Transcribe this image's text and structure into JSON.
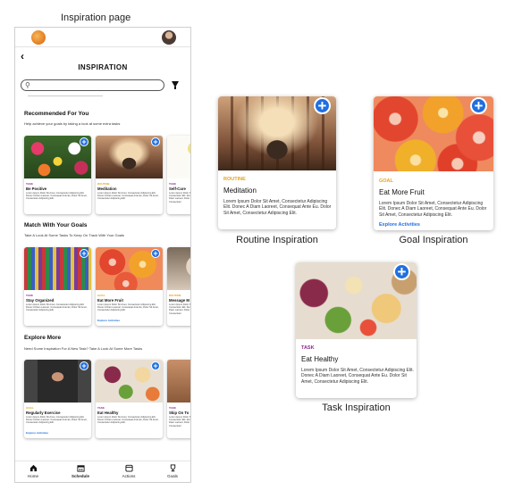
{
  "labels": {
    "inspiration_page": "Inspiration page",
    "routine": "Routine Inspiration",
    "goal": "Goal Inspiration",
    "task": "Task Inspiration"
  },
  "header": {
    "back": "‹",
    "title": "INSPIRATION"
  },
  "sections": {
    "recommended": {
      "title": "Recommended For You",
      "subtitle": "Help achieve your goals by taking a look at some extra tasks"
    },
    "match": {
      "title": "Match With Your Goals",
      "subtitle": "Take A Look At Some Tasks To Keep On Track With Your Goals"
    },
    "explore": {
      "title": "Explore More",
      "subtitle": "Need Some Inspiration For A New Task? Take A Look At Some More Tasks"
    }
  },
  "cards": {
    "r1": {
      "tag": "TASK",
      "name": "Be Positive",
      "desc": "Lorem Ipsum Dolor Sit Amet, Consectetur Adipiscing Elit. Donec A Diam Laoreet, Consequat Ante Eu, Dolor Sit Amet, Consectetur Adipiscing Elit.",
      "link": ""
    },
    "r2": {
      "tag": "ROUTINE",
      "name": "Meditation",
      "desc": "Lorem Ipsum Dolor Sit Amet, Consectetur Adipiscing Elit. Donec A Diam Laoreet, Consequat Ante Eu, Dolor Sit Amet, Consectetur Adipiscing Elit.",
      "link": ""
    },
    "r3": {
      "tag": "TASK",
      "name": "Self-Care",
      "desc": "Lorem Ipsum Dolor Sit Amet, Consectetur Elit. Donec A Diam Laoreet, Dolor Sit Amet, Consectetur",
      "link": ""
    },
    "m1": {
      "tag": "TASK",
      "name": "Stay Organized",
      "desc": "Lorem Ipsum Dolor Sit Amet, Consectetur Adipiscing Elit. Donec A Diam Laoreet, Consequat Ante Eu, Dolor Sit Amet, Consectetur Adipiscing Elit.",
      "link": ""
    },
    "m2": {
      "tag": "GOAL",
      "name": "Eat More Fruit",
      "desc": "Lorem Ipsum Dolor Sit Amet, Consectetur Adipiscing Elit. Donec A Diam Laoreet, Consequat Ante Eu, Dolor Sit Amet, Consectetur Adipiscing Elit.",
      "link": "Explore Activities"
    },
    "m3": {
      "tag": "ROUTINE",
      "name": "Message M",
      "desc": "Lorem Ipsum Dolor Sit Amet, Consectetur Elit. Donec A Diam Laoreet, Dolor Sit Amet, Consectetur",
      "link": ""
    },
    "e1": {
      "tag": "GOAL",
      "name": "Regularly Exercise",
      "desc": "Lorem Ipsum Dolor Sit Amet, Consectetur Adipiscing Elit. Donec A Diam Laoreet, Consequat Ante Eu, Dolor Sit Amet, Consectetur Adipiscing Elit.",
      "link": "Explore Activities"
    },
    "e2": {
      "tag": "TASK",
      "name": "Eat Healthy",
      "desc": "Lorem Ipsum Dolor Sit Amet, Consectetur Adipiscing Elit. Donec A Diam Laoreet, Consequat Ante Eu, Dolor Sit Amet, Consectetur Adipiscing Elit.",
      "link": ""
    },
    "e3": {
      "tag": "TASK",
      "name": "Skip On To",
      "desc": "Lorem Ipsum Dolor Sit Amet, Consectetur Elit. Donec A Diam Laoreet, Dolor Sit Amet, Consectetur",
      "link": ""
    }
  },
  "big": {
    "routine": {
      "tag": "ROUTINE",
      "name": "Meditation",
      "desc": "Lorem Ipsum Dolor Sit Amet, Consectetur Adipiscing Elit. Donec A Diam Laoreet, Consequat Ante Eu. Dolor Sit Amet, Consectetur Adipiscing Elit."
    },
    "goal": {
      "tag": "GOAL",
      "name": "Eat More Fruit",
      "desc": "Lorem Ipsum Dolor Sit Amet, Consectetur Adipiscing Elit. Donec A Diam Laoreet, Consequat Ante Eu. Dolor Sit Amet, Consectetur Adipiscing Elit.",
      "link": "Explore Activities"
    },
    "task": {
      "tag": "TASK",
      "name": "Eat Healthy",
      "desc": "Lorem Ipsum Dolor Sit Amet, Consectetur Adipiscing Elit. Donec A Diam Laoreet, Consequat Ante Eu. Dolor Sit Amet, Consectetur Adipiscing Elit."
    }
  },
  "plus": "+",
  "nav": [
    {
      "label": "Home",
      "icon": "home-icon"
    },
    {
      "label": "Schedule",
      "icon": "calendar-icon"
    },
    {
      "label": "Actions",
      "icon": "actions-icon"
    },
    {
      "label": "Goals",
      "icon": "trophy-icon"
    }
  ],
  "colors": {
    "accent": "#1f6fe0",
    "routine_tag": "#e6a21a",
    "task_tag": "#8a2a8a",
    "goal_tag": "#e6a21a"
  }
}
